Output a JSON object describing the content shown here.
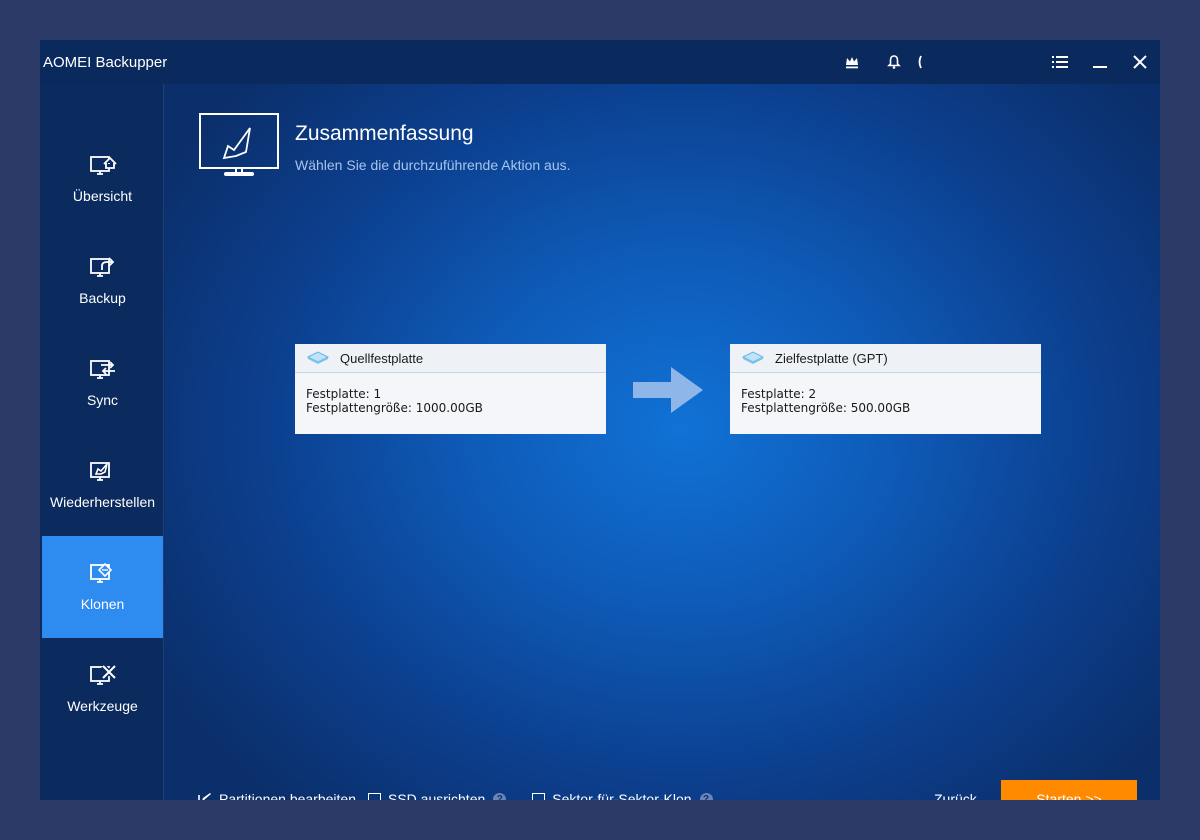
{
  "app": {
    "title": "AOMEI Backupper"
  },
  "titlebar": {
    "icons": [
      "crown-icon",
      "bell-icon",
      "help-icon",
      "menu-icon",
      "minimize-icon",
      "close-icon"
    ]
  },
  "sidebar": {
    "items": [
      {
        "label": "Übersicht",
        "icon": "home-monitor-icon"
      },
      {
        "label": "Backup",
        "icon": "backup-monitor-icon"
      },
      {
        "label": "Sync",
        "icon": "sync-monitor-icon"
      },
      {
        "label": "Wiederherstellen",
        "icon": "restore-monitor-icon"
      },
      {
        "label": "Klonen",
        "icon": "clone-monitor-icon",
        "active": true
      },
      {
        "label": "Werkzeuge",
        "icon": "tools-monitor-icon"
      }
    ]
  },
  "main": {
    "title": "Zusammenfassung",
    "subtitle": "Wählen Sie die durchzuführende Aktion aus.",
    "source": {
      "heading": "Quellfestplatte",
      "disk": "Festplatte: 1",
      "size": "Festplattengröße: 1000.00GB"
    },
    "target": {
      "heading": "Zielfestplatte (GPT)",
      "disk": "Festplatte: 2",
      "size": "Festplattengröße: 500.00GB"
    }
  },
  "footer": {
    "edit_partitions": "Partitionen bearbeiten",
    "ssd_align": "SSD ausrichten",
    "sector_clone": "Sektor-für-Sektor-Klon",
    "back": "Zurück",
    "start": "Starten >>"
  },
  "colors": {
    "accent": "#2e8bf0",
    "start_button": "#ff8a00",
    "window_bg": "#0c2f6d"
  }
}
